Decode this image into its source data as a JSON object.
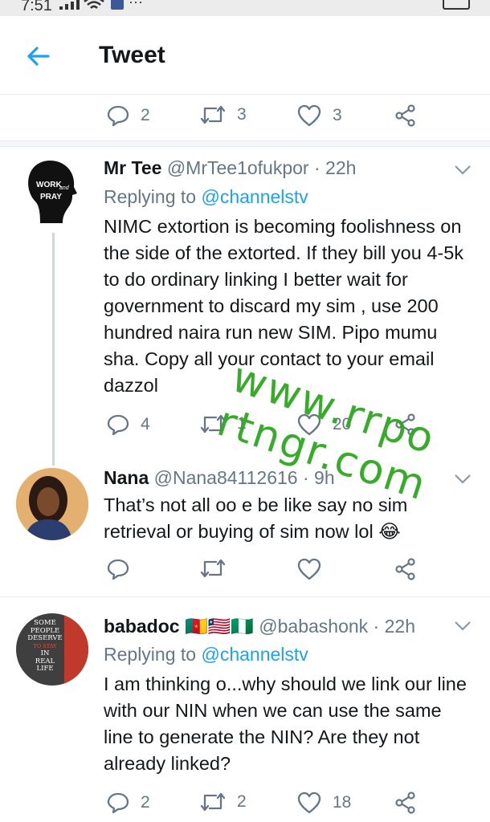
{
  "status_bar": {
    "time": "7:51",
    "more": "···"
  },
  "header": {
    "title": "Tweet"
  },
  "top_actions": {
    "replies": "2",
    "retweets": "3",
    "likes": "3"
  },
  "tweets": [
    {
      "name": "Mr Tee",
      "handle": "@MrTee1ofukpor · 22h",
      "replying_label": "Replying to",
      "replying_to": "@channelstv",
      "text": "NIMC extortion is becoming foolishness on the side of the extorted. If they bill you 4-5k to do ordinary linking I better wait for government to discard my sim , use 200 hundred naira run new SIM. Pipo mumu sha. Copy all your contact to your email dazzol",
      "avatar_text_1": "WORK",
      "avatar_text_2": "and",
      "avatar_text_3": "PRAY",
      "replies": "4",
      "retweets": "1",
      "likes": "20"
    },
    {
      "name": "Nana",
      "handle": "@Nana84112616 · 9h",
      "text": "That’s not all oo e be like say no sim retrieval or buying of sim now lol 😂"
    },
    {
      "name": "babadoc",
      "flags": "🇨🇲🇱🇷🇳🇬",
      "handle": "@babashonk · 22h",
      "replying_label": "Replying to",
      "replying_to": "@channelstv",
      "text": "I am thinking o...why should we link our line with our NIN when we can use the same line to generate the NIN? Are they not already linked?",
      "avatar_lines": [
        "SOME",
        "PEOPLE",
        "DESERVE",
        "TO STAY",
        "IN",
        "REAL",
        "LIFE"
      ],
      "replies": "2",
      "retweets": "2",
      "likes": "18"
    }
  ],
  "watermark": {
    "line1": "www.rrpo",
    "line2": "rtngr.com"
  },
  "colors": {
    "accent": "#1da1f2",
    "muted": "#657786",
    "watermark": "#2ea81f"
  }
}
